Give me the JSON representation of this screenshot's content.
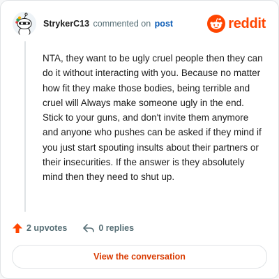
{
  "comment": {
    "author": "StrykerC13",
    "action_text": "commented on",
    "target_text": "post",
    "body": "NTA, they want to be ugly cruel people then they can do it without interacting with you. Because no matter how fit they make those bodies, being terrible and cruel will Always make someone ugly in the end. Stick to your guns, and don't invite them anymore and anyone who pushes can be asked if they mind if you just start spouting insults about their partners or their insecurities. If the answer is they absolutely mind then they need to shut up."
  },
  "brand": {
    "name": "reddit",
    "color": "#ff4500"
  },
  "stats": {
    "upvotes": "2 upvotes",
    "replies": "0 replies"
  },
  "cta": {
    "label": "View the conversation"
  },
  "icons": {
    "avatar": "snoo-avatar-icon",
    "brand": "reddit-logo-icon",
    "upvote": "upvote-arrow-icon",
    "reply": "reply-arrow-icon"
  }
}
